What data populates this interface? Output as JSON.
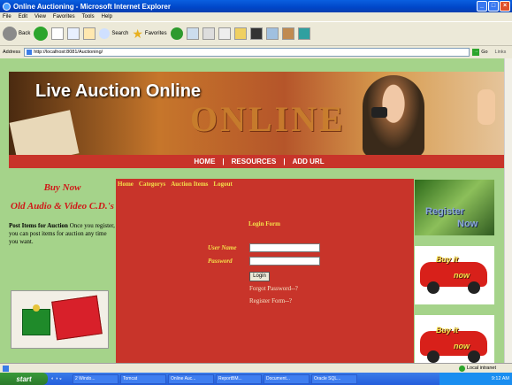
{
  "window": {
    "title": "Online Auctioning - Microsoft Internet Explorer"
  },
  "menubar": [
    "File",
    "Edit",
    "View",
    "Favorites",
    "Tools",
    "Help"
  ],
  "toolbar": {
    "back": "Back",
    "search": "Search",
    "favorites": "Favorites"
  },
  "address": {
    "label": "Address",
    "url": "http://localhost:8081/Auctioning/",
    "go": "Go",
    "links": "Links"
  },
  "banner": {
    "title": "Live Auction Online",
    "big": "ONLINE"
  },
  "nav": [
    "HOME",
    "|",
    "RESOURCES",
    "|",
    "ADD URL"
  ],
  "left": {
    "buy": "Buy Now",
    "old": "Old Audio & Video C.D.'s",
    "post_bold": "Post Items for Auction",
    "post_text": "Once you register, you can post items for auction any time you want."
  },
  "menu": [
    "Home",
    "Categorys",
    "Auction Items",
    "Logout"
  ],
  "login": {
    "title": "Login Form",
    "user_label": "User Name",
    "password_label": "Password",
    "button": "Login",
    "forgot": "Forgot Password--?",
    "register": "Register Form--?"
  },
  "right": {
    "register_line1": "Register",
    "register_line2": "Now",
    "buy1": "Buy it",
    "buy2": "now"
  },
  "status": {
    "zone": "Local intranet"
  },
  "taskbar": {
    "start": "start",
    "tasks": [
      "2 Windo...",
      "Tomcat",
      "Online Auc...",
      "ReportBM...",
      "Document...",
      "Oracle SQL..."
    ],
    "clock": "9:12 AM"
  }
}
